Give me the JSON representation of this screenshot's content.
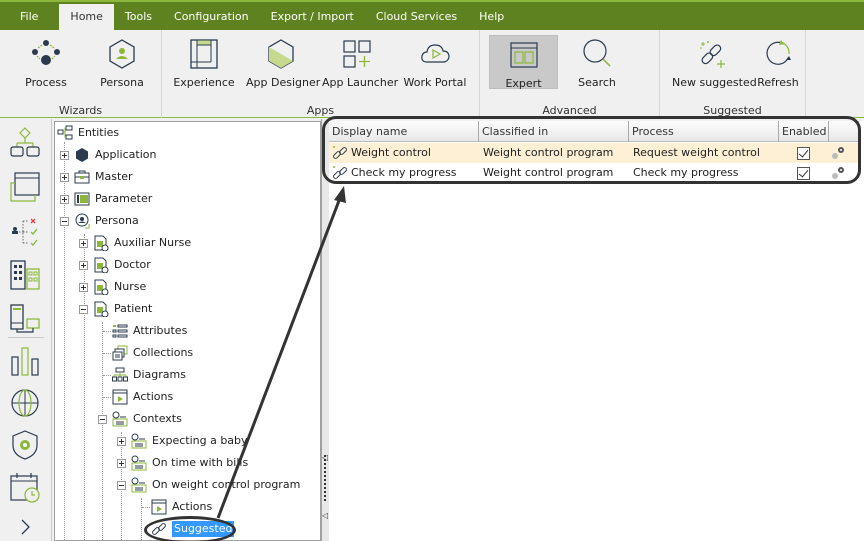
{
  "menu": {
    "items": [
      "File",
      "Home",
      "Tools",
      "Configuration",
      "Export / Import",
      "Cloud Services",
      "Help"
    ],
    "active": "Home"
  },
  "ribbon": {
    "groups": [
      {
        "label": "Wizards",
        "buttons": [
          {
            "label": "Process",
            "icon": "process-icon"
          },
          {
            "label": "Persona",
            "icon": "persona-icon"
          }
        ]
      },
      {
        "label": "Apps",
        "buttons": [
          {
            "label": "Experience",
            "icon": "experience-icon"
          },
          {
            "label": "App Designer",
            "icon": "app-designer-icon"
          },
          {
            "label": "App Launcher",
            "icon": "app-launcher-icon"
          },
          {
            "label": "Work Portal",
            "icon": "work-portal-icon"
          }
        ]
      },
      {
        "label": "Advanced",
        "buttons": [
          {
            "label": "Expert",
            "icon": "expert-icon",
            "selected": true
          },
          {
            "label": "Search",
            "icon": "search-icon"
          }
        ]
      },
      {
        "label": "Suggested",
        "buttons": [
          {
            "label": "New suggested",
            "icon": "new-suggested-icon"
          },
          {
            "label": "Refresh",
            "icon": "refresh-icon"
          }
        ]
      }
    ]
  },
  "iconstrip": {
    "items": [
      "process-model-icon",
      "window-icon",
      "rules-icon",
      "organization-icon",
      "devices-icon",
      "analytics-icon",
      "globe-icon",
      "security-icon",
      "scheduler-icon",
      "expand-chevron-icon"
    ]
  },
  "tree": {
    "nodes": [
      {
        "label": "Entities",
        "level": 0
      },
      {
        "label": "Application",
        "level": 1,
        "expander": "plus"
      },
      {
        "label": "Master",
        "level": 1,
        "expander": "plus"
      },
      {
        "label": "Parameter",
        "level": 1,
        "expander": "plus"
      },
      {
        "label": "Persona",
        "level": 1,
        "expander": "minus"
      },
      {
        "label": "Auxiliar Nurse",
        "level": 2,
        "expander": "plus"
      },
      {
        "label": "Doctor",
        "level": 2,
        "expander": "plus"
      },
      {
        "label": "Nurse",
        "level": 2,
        "expander": "plus"
      },
      {
        "label": "Patient",
        "level": 2,
        "expander": "minus"
      },
      {
        "label": "Attributes",
        "level": 3
      },
      {
        "label": "Collections",
        "level": 3
      },
      {
        "label": "Diagrams",
        "level": 3
      },
      {
        "label": "Actions",
        "level": 3
      },
      {
        "label": "Contexts",
        "level": 3,
        "expander": "minus"
      },
      {
        "label": "Expecting a baby",
        "level": 4,
        "expander": "plus"
      },
      {
        "label": "On time with bills",
        "level": 4,
        "expander": "plus"
      },
      {
        "label": "On weight control program",
        "level": 4,
        "expander": "minus"
      },
      {
        "label": "Actions",
        "level": 5
      },
      {
        "label": "Suggested",
        "level": 5,
        "selected": true
      }
    ]
  },
  "grid": {
    "columns": [
      "Display name",
      "Classified in",
      "Process",
      "Enabled",
      ""
    ],
    "rows": [
      {
        "display_name": "Weight control",
        "classified_in": "Weight control program",
        "process": "Request weight control",
        "enabled": true,
        "selected": true
      },
      {
        "display_name": "Check my progress",
        "classified_in": "Weight control program",
        "process": "Check my progress",
        "enabled": true,
        "selected": false
      }
    ]
  },
  "colors": {
    "brand_green": "#5f8220",
    "accent_green": "#8bb83a",
    "selection_blue": "#3399ff",
    "row_highlight": "#fdf0d5",
    "icon_navy": "#2b3a4e"
  }
}
